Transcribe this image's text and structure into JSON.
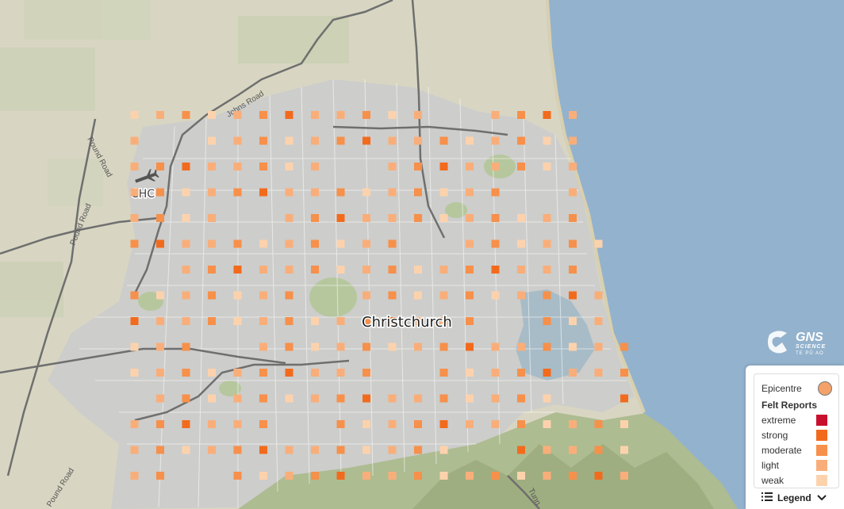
{
  "map": {
    "city_label": "Christchurch",
    "airport_label": "CHC",
    "road_labels": [
      "Johns Road",
      "Pound Road",
      "Pound Road",
      "Pound Road",
      "Tunn"
    ],
    "colors": {
      "sea": "#93b2cd",
      "land": "#d9d6c4",
      "urban": "#cfcfcf",
      "road": "#ffffff",
      "major_road": "#6a6a6a",
      "park": "#b9c9a4",
      "hill": "#a9b98e"
    }
  },
  "logo": {
    "name": "GNS",
    "subtitle": "SCIENCE",
    "maori": "TE PŪ AO"
  },
  "legend": {
    "epicentre_label": "Epicentre",
    "epicentre_color": "#f4a26a",
    "felt_reports_title": "Felt Reports",
    "levels": [
      {
        "label": "extreme",
        "color": "#c8102e"
      },
      {
        "label": "strong",
        "color": "#f26b1d"
      },
      {
        "label": "moderate",
        "color": "#f7904a"
      },
      {
        "label": "light",
        "color": "#f9ae7a"
      },
      {
        "label": "weak",
        "color": "#fcd2ad"
      }
    ],
    "toggle_label": "Legend",
    "toggle_icon": "list-icon",
    "chevron_icon": "chevron-down-icon"
  }
}
